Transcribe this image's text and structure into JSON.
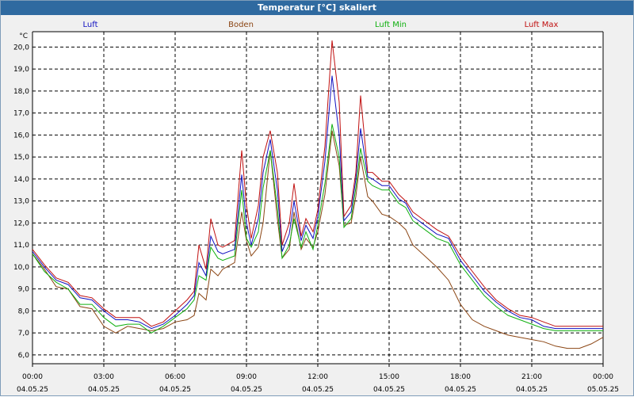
{
  "window": {
    "title": "Temperatur [°C] skaliert"
  },
  "chart_data": {
    "type": "line",
    "title": "Temperatur [°C] skaliert",
    "y_unit": "°C",
    "ylim": [
      5.6,
      20.7
    ],
    "y_ticks": [
      "6,0",
      "7,0",
      "8,0",
      "9,0",
      "10,0",
      "11,0",
      "12,0",
      "13,0",
      "14,0",
      "15,0",
      "16,0",
      "17,0",
      "18,0",
      "19,0",
      "20,0"
    ],
    "x_ticks": [
      {
        "time": "00:00",
        "date": "04.05.25"
      },
      {
        "time": "03:00",
        "date": "04.05.25"
      },
      {
        "time": "06:00",
        "date": "04.05.25"
      },
      {
        "time": "09:00",
        "date": "04.05.25"
      },
      {
        "time": "12:00",
        "date": "04.05.25"
      },
      {
        "time": "15:00",
        "date": "04.05.25"
      },
      {
        "time": "18:00",
        "date": "04.05.25"
      },
      {
        "time": "21:00",
        "date": "04.05.25"
      },
      {
        "time": "00:00",
        "date": "05.05.25"
      }
    ],
    "x_hours": [
      0,
      0.5,
      1,
      1.5,
      2,
      2.5,
      3,
      3.5,
      4,
      4.5,
      5,
      5.5,
      6,
      6.5,
      6.8,
      7,
      7.3,
      7.5,
      7.8,
      8,
      8.5,
      8.8,
      9,
      9.2,
      9.5,
      9.7,
      10,
      10.3,
      10.5,
      10.8,
      11,
      11.3,
      11.5,
      11.8,
      12,
      12.3,
      12.6,
      12.9,
      13.1,
      13.4,
      13.6,
      13.8,
      14.1,
      14.3,
      14.7,
      15,
      15.4,
      15.7,
      16,
      16.5,
      17,
      17.5,
      18,
      18.5,
      19,
      19.5,
      20,
      20.5,
      21,
      21.5,
      22,
      22.5,
      23,
      23.5,
      24
    ],
    "series": [
      {
        "name": "Luft",
        "color": "#1010c0",
        "values": [
          10.7,
          10.0,
          9.4,
          9.2,
          8.6,
          8.5,
          8.0,
          7.6,
          7.6,
          7.5,
          7.2,
          7.4,
          7.8,
          8.3,
          8.7,
          10.2,
          9.6,
          11.4,
          10.7,
          10.6,
          10.8,
          14.2,
          12.0,
          11.0,
          12.2,
          14.3,
          15.8,
          13.5,
          10.7,
          11.5,
          13.0,
          11.2,
          11.9,
          11.3,
          12.3,
          14.8,
          18.7,
          16.0,
          12.1,
          12.5,
          14.0,
          16.3,
          14.1,
          14.0,
          13.7,
          13.7,
          13.1,
          12.9,
          12.3,
          11.9,
          11.5,
          11.3,
          10.3,
          9.6,
          8.9,
          8.4,
          8.0,
          7.7,
          7.6,
          7.3,
          7.2,
          7.2,
          7.2,
          7.2,
          7.2
        ]
      },
      {
        "name": "Boden",
        "color": "#8b4513",
        "values": [
          10.6,
          9.9,
          9.1,
          9.0,
          8.2,
          8.1,
          7.3,
          7.0,
          7.3,
          7.2,
          7.1,
          7.2,
          7.5,
          7.6,
          7.8,
          8.8,
          8.5,
          9.9,
          9.6,
          9.9,
          10.2,
          12.5,
          11.2,
          10.5,
          10.9,
          12.0,
          15.3,
          12.2,
          10.4,
          10.8,
          12.5,
          10.8,
          11.3,
          10.9,
          11.6,
          13.3,
          16.2,
          14.6,
          11.9,
          12.0,
          13.2,
          15.0,
          13.2,
          13.0,
          12.4,
          12.3,
          12.0,
          11.7,
          11.0,
          10.5,
          10.0,
          9.4,
          8.3,
          7.6,
          7.3,
          7.1,
          6.9,
          6.8,
          6.7,
          6.6,
          6.4,
          6.3,
          6.3,
          6.5,
          6.8
        ]
      },
      {
        "name": "Luft Min",
        "color": "#10b010",
        "values": [
          10.6,
          9.8,
          9.3,
          9.0,
          8.3,
          8.3,
          7.7,
          7.3,
          7.4,
          7.4,
          7.0,
          7.3,
          7.7,
          8.1,
          8.5,
          9.6,
          9.4,
          10.9,
          10.4,
          10.3,
          10.5,
          13.5,
          11.3,
          10.9,
          11.6,
          13.6,
          15.3,
          12.7,
          10.4,
          11.0,
          12.2,
          10.9,
          11.6,
          10.8,
          11.9,
          13.8,
          16.5,
          15.0,
          11.8,
          12.2,
          13.6,
          15.4,
          13.9,
          13.7,
          13.5,
          13.5,
          12.9,
          12.7,
          12.1,
          11.7,
          11.3,
          11.1,
          10.1,
          9.4,
          8.7,
          8.2,
          7.8,
          7.6,
          7.4,
          7.2,
          7.1,
          7.1,
          7.1,
          7.1,
          7.1
        ]
      },
      {
        "name": "Luft Max",
        "color": "#c01010",
        "values": [
          10.8,
          10.1,
          9.5,
          9.3,
          8.7,
          8.6,
          8.1,
          7.7,
          7.7,
          7.7,
          7.3,
          7.5,
          8.0,
          8.5,
          8.9,
          11.0,
          9.9,
          12.2,
          11.0,
          10.9,
          11.2,
          15.3,
          12.8,
          11.3,
          12.8,
          15.0,
          16.2,
          14.3,
          11.0,
          12.0,
          13.8,
          11.4,
          12.2,
          11.6,
          12.6,
          15.5,
          20.3,
          17.5,
          12.3,
          12.8,
          14.3,
          17.8,
          14.3,
          14.3,
          13.9,
          13.9,
          13.3,
          13.0,
          12.5,
          12.1,
          11.7,
          11.4,
          10.5,
          9.8,
          9.1,
          8.5,
          8.1,
          7.8,
          7.7,
          7.5,
          7.3,
          7.3,
          7.3,
          7.3,
          7.3
        ]
      }
    ],
    "grid": true,
    "legend_position": "top"
  }
}
